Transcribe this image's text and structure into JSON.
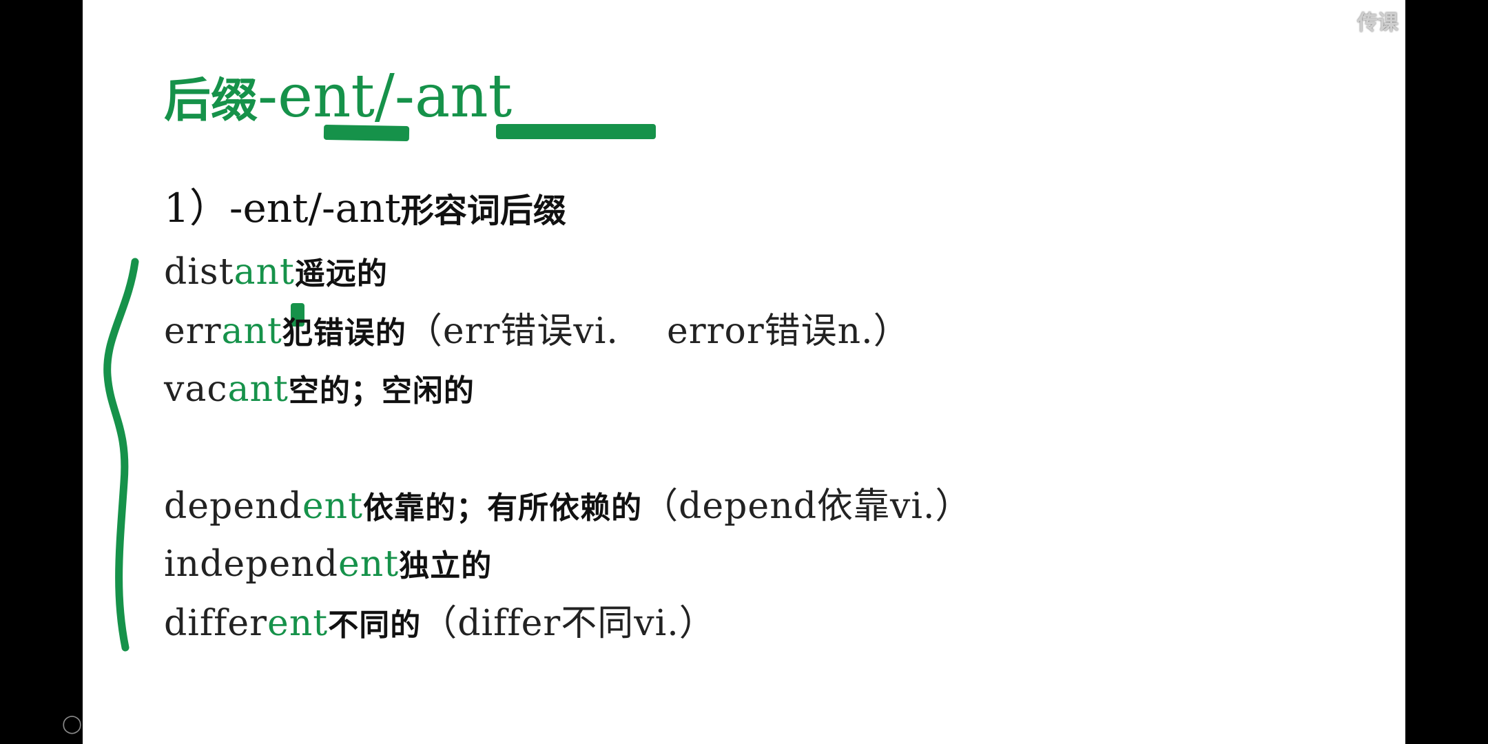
{
  "watermark": "传课",
  "title": {
    "prefix": "后缀",
    "suffix": "-ent/-ant"
  },
  "subtitle": {
    "number": "1）-ent/-ant",
    "text": "形容词后缀"
  },
  "lines": [
    {
      "root": "dist",
      "suffix": "ant",
      "cn": "遥远的",
      "rest": ""
    },
    {
      "root": "err",
      "suffix": "ant",
      "cn": "犯错误的",
      "rest": "（err错误vi.    error错误n.）"
    },
    {
      "root": "vac",
      "suffix": "ant",
      "cn": "空的；空闲的",
      "rest": ""
    },
    {
      "root": "depend",
      "suffix": "ent",
      "cn": "依靠的；有所依赖的",
      "rest": "（depend依靠vi.）"
    },
    {
      "root": "independ",
      "suffix": "ent",
      "cn": "独立的",
      "rest": ""
    },
    {
      "root": "differ",
      "suffix": "ent",
      "cn": "不同的",
      "rest": "（differ不同vi.）"
    }
  ],
  "colors": {
    "accent": "#16924a",
    "text": "#222222",
    "background": "#ffffff"
  }
}
